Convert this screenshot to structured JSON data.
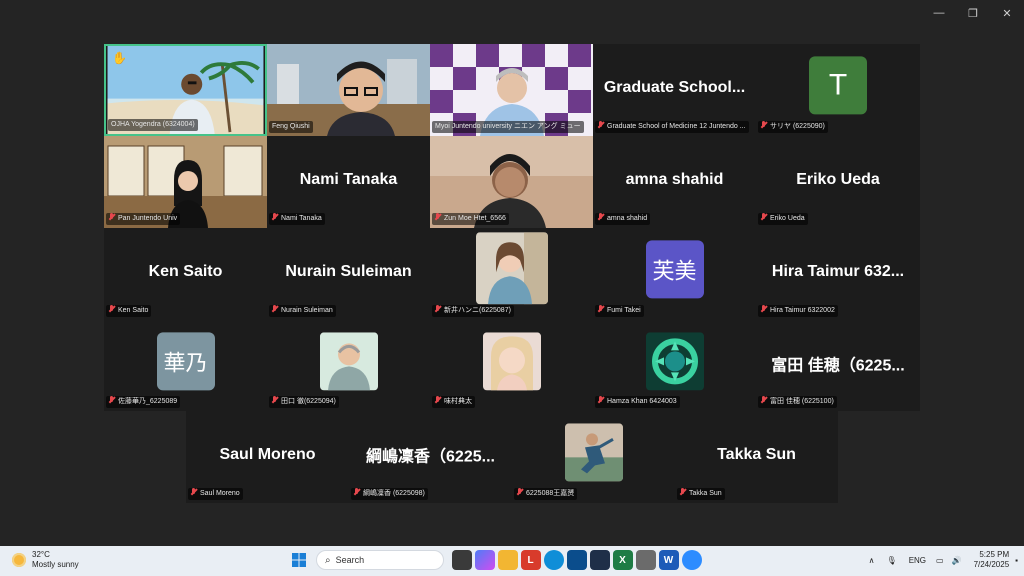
{
  "window_controls": {
    "minimize": "—",
    "maximize": "❐",
    "close": "✕"
  },
  "participants_row1": [
    {
      "label": "OJHA Yogendra (6324004)",
      "video": true,
      "active": true,
      "hand": "✋"
    },
    {
      "label": "Feng Qiushi",
      "video": true
    },
    {
      "label": "Myoi Juntendo university ニエン アング ミュー",
      "video": true
    },
    {
      "label": "Graduate School of Medicine 12 Juntendo ...",
      "name": "Graduate  School...",
      "video": false
    },
    {
      "label": "サリヤ (6225090)",
      "avatar": "T",
      "avatar_color": "#3f7d3b",
      "video": false
    }
  ],
  "participants_row2": [
    {
      "label": "Pan Juntendo Univ",
      "video": true
    },
    {
      "label": "Nami Tanaka",
      "name": "Nami Tanaka",
      "video": false
    },
    {
      "label": "Zun Moe Htet_6566",
      "video": true
    },
    {
      "label": "amna shahid",
      "name": "amna shahid",
      "video": false
    },
    {
      "label": "Eriko Ueda",
      "name": "Eriko Ueda",
      "video": false
    }
  ],
  "participants_row3": [
    {
      "label": "Ken Saito",
      "name": "Ken Saito",
      "video": false
    },
    {
      "label": "Nurain Suleiman",
      "name": "Nurain Suleiman",
      "video": false
    },
    {
      "label": "新井ハンニ(6225087)",
      "video": "photo"
    },
    {
      "label": "Fumi Takei",
      "avatar": "芙美",
      "avatar_color": "#5b55c7",
      "video": false
    },
    {
      "label": "Hira Taimur 6322002",
      "name": "Hira Taimur 632...",
      "video": false
    }
  ],
  "participants_row4": [
    {
      "label": "佐藤華乃_6225089",
      "avatar": "華乃",
      "avatar_color": "#7d95a0",
      "video": false
    },
    {
      "label": "田口 徹(6225094)",
      "video": "photo"
    },
    {
      "label": "味村典太",
      "video": "photo"
    },
    {
      "label": "Hamza Khan 6424003",
      "video": "photo"
    },
    {
      "label": "富田 佳穂 (6225100)",
      "name": "富田 佳穂（6225...",
      "video": false
    }
  ],
  "participants_row5": [
    {
      "label": "Saul Moreno",
      "name": "Saul Moreno",
      "video": false
    },
    {
      "label": "綱嶋凜香 (6225098)",
      "name": "綱嶋凜香（6225...",
      "video": false
    },
    {
      "label": "6225088王嘉赟",
      "video": "photo"
    },
    {
      "label": "Takka Sun",
      "name": "Takka Sun",
      "video": false
    }
  ],
  "taskbar": {
    "weather_temp": "32°C",
    "weather_desc": "Mostly sunny",
    "search_placeholder": "Search",
    "tray_lang": "ENG",
    "time": "5:25 PM",
    "date": "7/24/2025"
  }
}
